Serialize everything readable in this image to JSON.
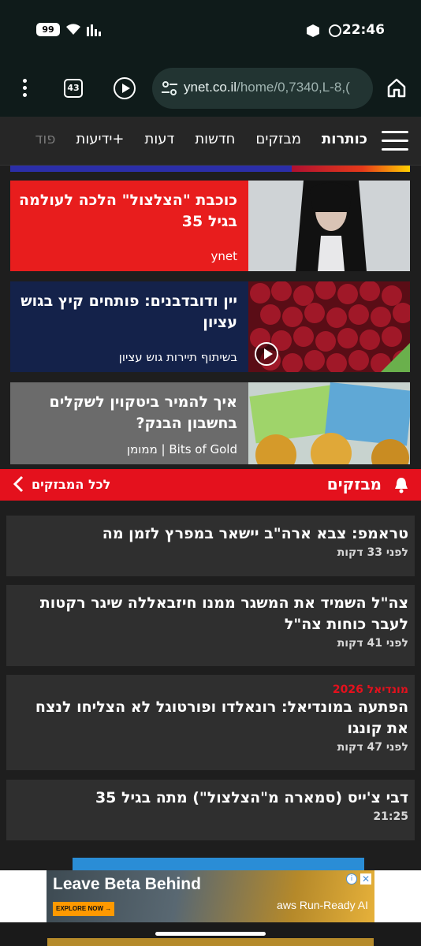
{
  "status_bar": {
    "time": "22:46",
    "battery": "99"
  },
  "browser": {
    "tabs_count": "43",
    "url_host": "ynet.co.il",
    "url_path": "/home/0,7340,L-8,(",
    "icons": [
      "menu-dots-icon",
      "tabs-icon",
      "play-icon",
      "site-settings-icon",
      "home-icon"
    ]
  },
  "nav": {
    "items": [
      "כותרות",
      "מבזקים",
      "חדשות",
      "דעות",
      "ידיעות+",
      "פוד"
    ]
  },
  "articles": [
    {
      "title": "כוכבת \"הצלצול\" הלכה לעולמה בגיל 35",
      "source": "ynet"
    },
    {
      "title": "יין ודובדבנים: פותחים קיץ בגוש עציון",
      "source": "בשיתוף תיירות גוש עציון"
    },
    {
      "title": "איך להמיר ביטקוין לשקלים בחשבון הבנק?",
      "source": "Bits of Gold | ממומן"
    }
  ],
  "flash": {
    "title": "מבזקים",
    "all_link": "לכל המבזקים",
    "items": [
      {
        "tag": "",
        "text": "טראמפ: צבא ארה\"ב יישאר במפרץ לזמן מה",
        "time": "לפני 33 דקות"
      },
      {
        "tag": "",
        "text": "צה\"ל השמיד את המשגר ממנו חיזבאללה שיגר רקטות לעבר כוחות צה\"ל",
        "time": "לפני 41 דקות"
      },
      {
        "tag": "מונדיאל 2026",
        "text": "הפתעה במונדיאל: רונאלדו ופורטוגל לא הצליחו לנצח את קונגו",
        "time": "לפני 47 דקות"
      },
      {
        "tag": "",
        "text": "דבי צ'ייס (סמארה מ\"הצלצול\") מתה בגיל 35",
        "time": "21:25"
      }
    ]
  },
  "ad": {
    "headline": "Leave Beta Behind",
    "cta": "EXPLORE NOW →",
    "brand": "aws Run-Ready AI"
  },
  "colors": {
    "accent_red": "#e4111d",
    "browser_bg": "#0f1b1a",
    "card_dark_blue": "#14224a"
  }
}
